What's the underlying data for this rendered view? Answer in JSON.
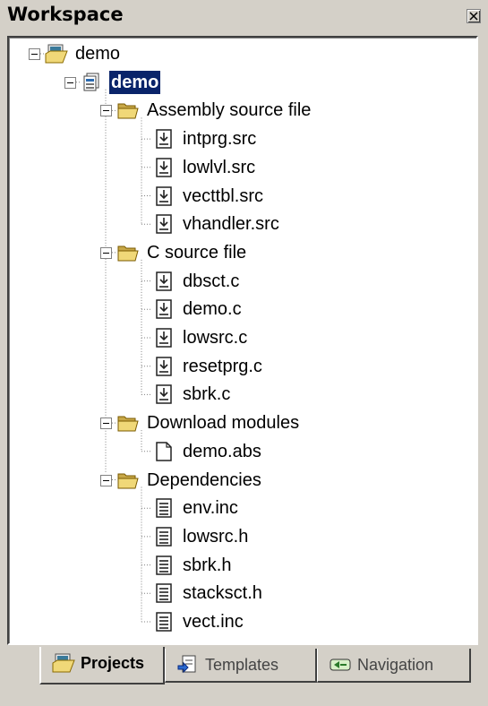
{
  "window": {
    "title": "Workspace",
    "close_glyph": "×"
  },
  "tree": {
    "root": {
      "label": "demo",
      "icon": "workspace-icon"
    },
    "project": {
      "label": "demo",
      "icon": "project-icon",
      "selected": true
    },
    "folders": [
      {
        "label": "Assembly source file",
        "icon": "folder-open-icon",
        "files": [
          {
            "label": "intprg.src",
            "icon": "source-file-icon"
          },
          {
            "label": "lowlvl.src",
            "icon": "source-file-icon"
          },
          {
            "label": "vecttbl.src",
            "icon": "source-file-icon"
          },
          {
            "label": "vhandler.src",
            "icon": "source-file-icon"
          }
        ]
      },
      {
        "label": "C source file",
        "icon": "folder-open-icon",
        "files": [
          {
            "label": "dbsct.c",
            "icon": "source-file-icon"
          },
          {
            "label": "demo.c",
            "icon": "source-file-icon"
          },
          {
            "label": "lowsrc.c",
            "icon": "source-file-icon"
          },
          {
            "label": "resetprg.c",
            "icon": "source-file-icon"
          },
          {
            "label": "sbrk.c",
            "icon": "source-file-icon"
          }
        ]
      },
      {
        "label": "Download modules",
        "icon": "folder-open-icon",
        "files": [
          {
            "label": "demo.abs",
            "icon": "blank-file-icon"
          }
        ]
      },
      {
        "label": "Dependencies",
        "icon": "folder-open-icon",
        "files": [
          {
            "label": "env.inc",
            "icon": "text-file-icon"
          },
          {
            "label": "lowsrc.h",
            "icon": "text-file-icon"
          },
          {
            "label": "sbrk.h",
            "icon": "text-file-icon"
          },
          {
            "label": "stacksct.h",
            "icon": "text-file-icon"
          },
          {
            "label": "vect.inc",
            "icon": "text-file-icon"
          }
        ]
      }
    ]
  },
  "tabs": [
    {
      "label": "Projects",
      "icon": "projects-tab-icon",
      "active": true
    },
    {
      "label": "Templates",
      "icon": "templates-tab-icon",
      "active": false
    },
    {
      "label": "Navigation",
      "icon": "navigation-tab-icon",
      "active": false
    }
  ],
  "colors": {
    "selection": "#0a246a",
    "folder": "#f0d878",
    "panel": "#d4d0c8"
  }
}
